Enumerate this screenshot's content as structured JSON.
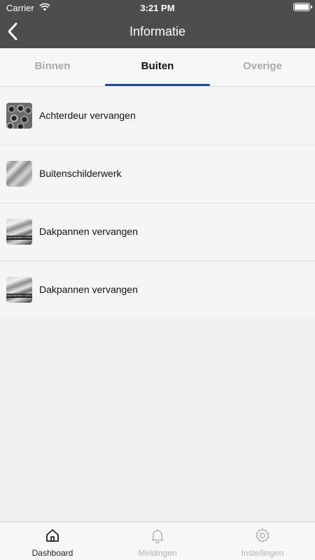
{
  "status_bar": {
    "carrier": "Carrier",
    "time": "3:21 PM",
    "wifi_icon": "wifi-icon",
    "battery_icon": "battery-icon"
  },
  "nav": {
    "title": "Informatie",
    "back_icon": "chevron-left-icon"
  },
  "tabs": [
    {
      "label": "Binnen",
      "active": false
    },
    {
      "label": "Buiten",
      "active": true
    },
    {
      "label": "Overige",
      "active": false
    }
  ],
  "items": [
    {
      "label": "Achterdeur vervangen",
      "thumbnail": "pipes-photo"
    },
    {
      "label": "Buitenschilderwerk",
      "thumbnail": "plaster-photo"
    },
    {
      "label": "Dakpannen vervangen",
      "thumbnail": "roof-photo",
      "thumb_caption": "DAKPANNEN VERVANGEN"
    },
    {
      "label": "Dakpannen vervangen",
      "thumbnail": "roof-photo",
      "thumb_caption": "DAKPANNEN VERVANGEN"
    }
  ],
  "tabbar": [
    {
      "label": "Dashboard",
      "icon": "home-icon",
      "active": true
    },
    {
      "label": "Meldingen",
      "icon": "bell-icon",
      "active": false
    },
    {
      "label": "Instellingen",
      "icon": "gear-icon",
      "active": false
    }
  ],
  "colors": {
    "header_bg": "#4d4d4d",
    "tab_indicator": "#1f4e8c",
    "inactive_text": "#a9a9a9"
  }
}
